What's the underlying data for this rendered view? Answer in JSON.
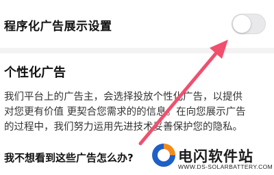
{
  "setting": {
    "label": "程序化广告展示设置",
    "toggle_on": false
  },
  "section": {
    "title": "个性化广告",
    "description_lines": [
      "我们平台上的广告主，会选择投放个性化广告，以提供",
      "对您更有价值 更契合您需求的的信息。在向您展示广告",
      "的过程中，我们努力运用先进技术妥善保护您的隐私。"
    ],
    "faq_question": "我不想看到这些广告怎么办?"
  },
  "annotation": {
    "arrow_color": "#f0506e"
  },
  "watermark": {
    "title": "电闪软件站",
    "url": "WWW.DS-SOLARBATTERY.COM",
    "colors": {
      "blue": "#1e5fc8",
      "orange": "#f28c1c"
    }
  }
}
